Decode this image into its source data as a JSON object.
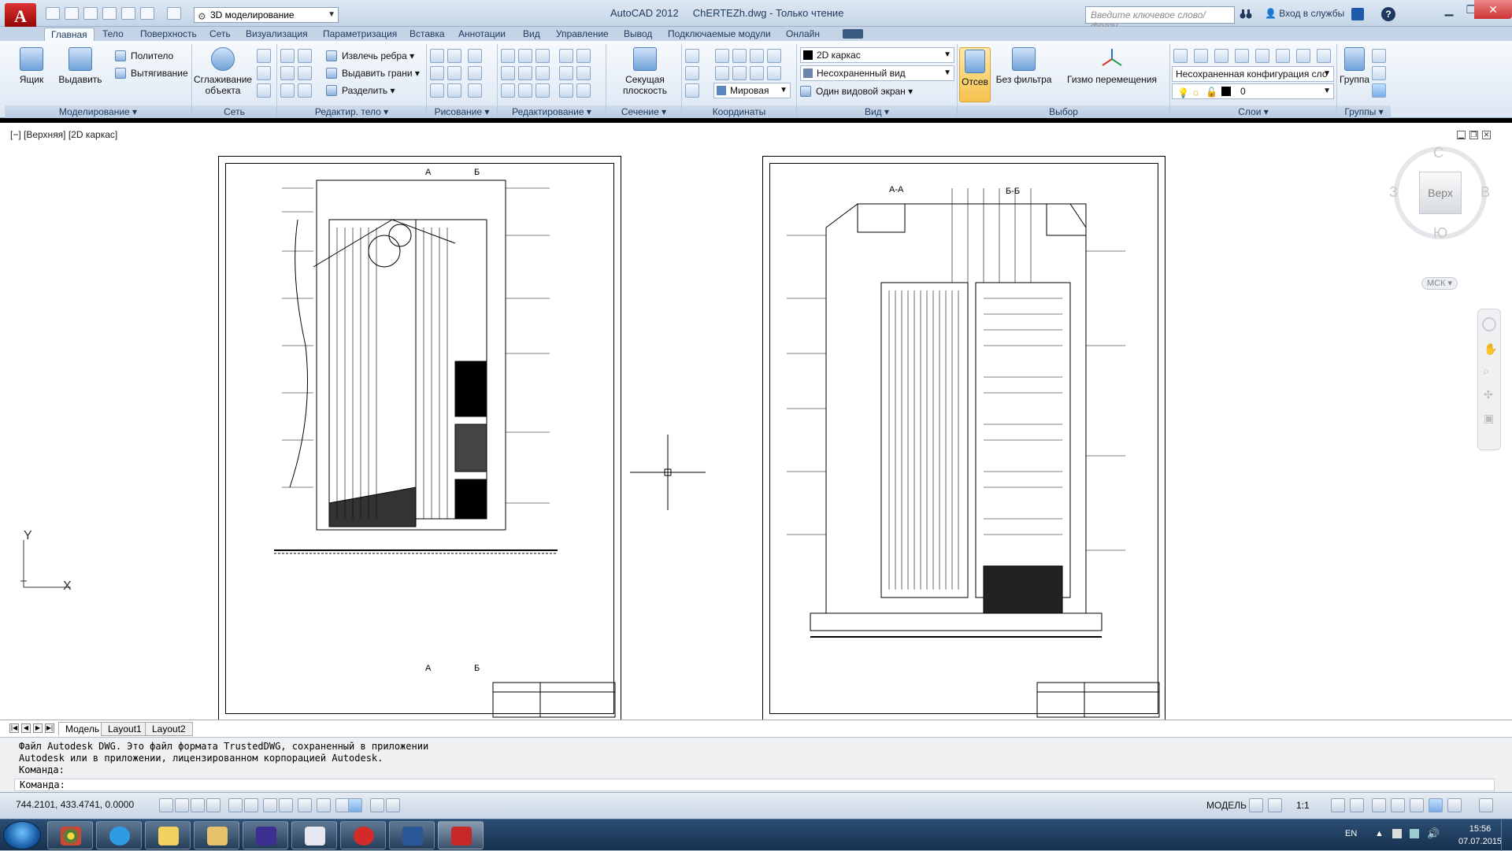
{
  "titlebar": {
    "workspace": "3D моделирование",
    "app_title": "AutoCAD 2012",
    "file_title": "ChERTEZh.dwg - Только чтение",
    "search_placeholder": "Введите ключевое слово/фразу",
    "signin": "Вход в службы"
  },
  "tabs": [
    "Главная",
    "Тело",
    "Поверхность",
    "Сеть",
    "Визуализация",
    "Параметризация",
    "Вставка",
    "Аннотации",
    "Вид",
    "Управление",
    "Вывод",
    "Подключаемые модули",
    "Онлайн"
  ],
  "ribbon": {
    "modeling": {
      "title": "Моделирование",
      "box": "Ящик",
      "extrude": "Выдавить",
      "polysolid": "Политело",
      "loft": "Вытягивание"
    },
    "mesh": {
      "title": "Сеть",
      "smooth": "Сглаживание объекта"
    },
    "solid_edit": {
      "title": "Редактир. тело",
      "extract_edges": "Извлечь ребра",
      "extrude_faces": "Выдавить грани",
      "separate": "Разделить"
    },
    "draw": {
      "title": "Рисование"
    },
    "modify": {
      "title": "Редактирование"
    },
    "section": {
      "title": "Сечение",
      "section_plane": "Секущая плоскость"
    },
    "coords": {
      "title": "Координаты",
      "world": "Мировая"
    },
    "view": {
      "title": "Вид",
      "visual_style": "2D каркас",
      "saved_view": "Несохраненный вид",
      "single_viewport": "Один видовой экран"
    },
    "selection": {
      "title": "Выбор",
      "culling": "Отсев",
      "no_filter": "Без фильтра",
      "gizmo": "Гизмо перемещения"
    },
    "layers": {
      "title": "Слои",
      "layer_state": "Несохраненная конфигурация сло",
      "layer_name": "0"
    },
    "groups": {
      "title": "Группы",
      "group": "Группа"
    }
  },
  "viewport": {
    "label": "[−] [Верхняя] [2D каркас]",
    "cube_face": "Верх",
    "dir_north": "С",
    "dir_south": "Ю",
    "dir_east": "В",
    "dir_west": "З",
    "ucs_label": "МСК",
    "ucs_x": "X",
    "ucs_y": "Y"
  },
  "sheets": {
    "left": {
      "section_a_top": "А",
      "section_b_top": "Б",
      "section_a_bottom": "А",
      "section_b_bottom": "Б"
    },
    "right": {
      "view_aa": "А-А",
      "view_bb": "Б-Б"
    }
  },
  "layout_tabs": [
    "Модель",
    "Layout1",
    "Layout2"
  ],
  "command": {
    "history": [
      "Файл Autodesk DWG. Это файл формата TrustedDWG, сохраненный в приложении",
      "Autodesk или в приложении, лицензированном корпорацией Autodesk.",
      "Команда:"
    ],
    "prompt": "Команда:"
  },
  "status": {
    "coords": "744.2101, 433.4741, 0.0000",
    "mode": "МОДЕЛЬ",
    "scale": "1:1"
  },
  "taskbar": {
    "lang": "EN",
    "time": "15:56",
    "date": "07.07.2015"
  },
  "colors": {
    "ribbon_bg": "#dce7f3",
    "accent_red": "#c62828",
    "taskbar": "#1f3d5f"
  }
}
